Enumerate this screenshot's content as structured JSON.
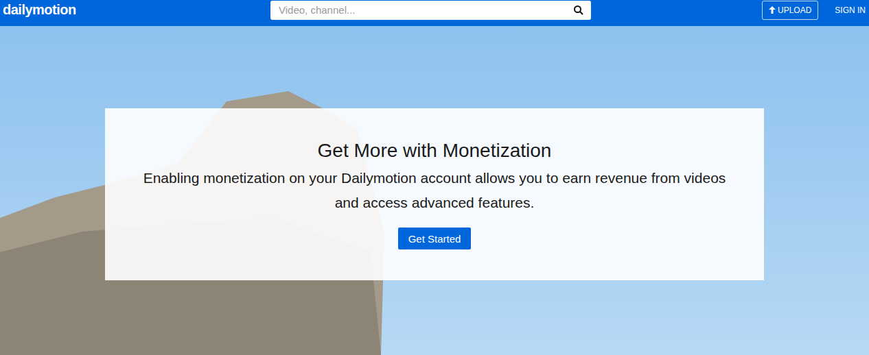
{
  "header": {
    "logo": "dailymotion",
    "search": {
      "placeholder": "Video, channel..."
    },
    "upload": {
      "label": "UPLOAD"
    },
    "sign_in": "SIGN IN"
  },
  "hero": {
    "title": "Get More with Monetization",
    "text": "Enabling monetization on your Dailymotion account allows you to earn revenue from videos and access advanced features.",
    "button": "Get Started"
  }
}
